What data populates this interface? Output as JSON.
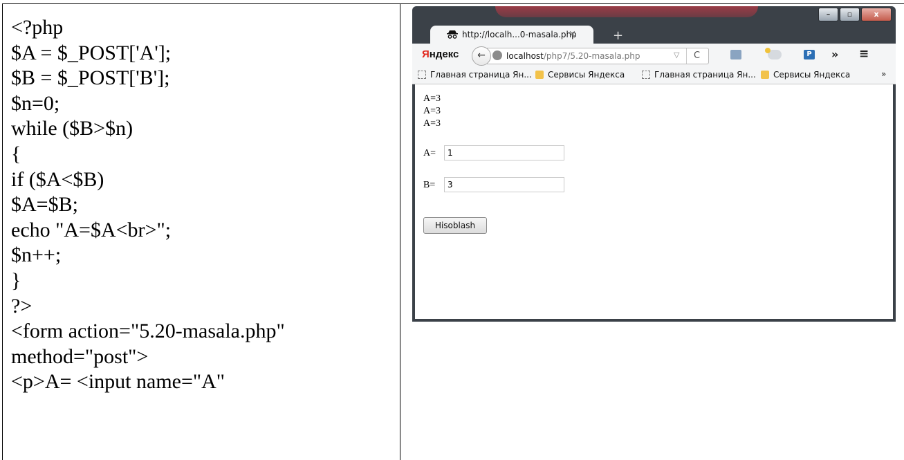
{
  "code_lines": [
    "<?php",
    "$A = $_POST['A'];",
    "$B = $_POST['B'];",
    "$n=0;",
    "while ($B>$n)",
    "{",
    "if ($A<$B)",
    "$A=$B;",
    "echo \"A=$A<br>\";",
    "$n++;",
    "}",
    "?>",
    "<form action=\"5.20-masala.php\"",
    "method=\"post\">",
    "<p>A= <input name=\"A\""
  ],
  "browser": {
    "tab_title": "http://localh...0-masala.php",
    "tab_close": "×",
    "new_tab": "+",
    "brand_first": "Я",
    "brand_rest": "ндекс",
    "back_glyph": "←",
    "url_host": "localhost",
    "url_path": "/php7/5.20-masala.php",
    "url_dropdown": "▽",
    "reload_glyph": "C",
    "p_icon_letter": "P",
    "more_glyph": "»",
    "menu_glyph": "≡",
    "bookmarks": [
      {
        "label": "Главная страница Ян...",
        "icon": "page-icon"
      },
      {
        "label": "Сервисы Яндекса",
        "icon": "folder-icon"
      },
      {
        "label": "Главная страница Ян...",
        "icon": "page-icon"
      },
      {
        "label": "Сервисы Яндекса",
        "icon": "folder-icon"
      }
    ],
    "bookmarks_more": "»",
    "window_buttons": {
      "minimize": "–",
      "maximize": "▫",
      "close": "x"
    }
  },
  "page": {
    "output_lines": [
      "A=3",
      "A=3",
      "A=3"
    ],
    "field_a_label": "A=",
    "field_a_value": "1",
    "field_b_label": "B=",
    "field_b_value": "3",
    "submit_label": "Hisoblash"
  }
}
